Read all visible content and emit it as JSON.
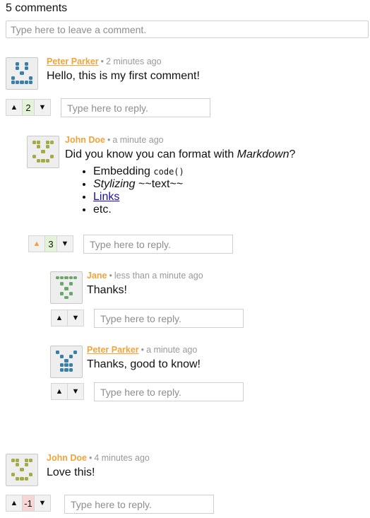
{
  "header": {
    "comment_count": "5 comments"
  },
  "new_comment": {
    "placeholder": "Type here to leave a comment."
  },
  "reply_placeholder": "Type here to reply.",
  "separator": "•",
  "vote": {
    "up_glyph": "▲",
    "down_glyph": "▼"
  },
  "colors": {
    "author": "#f2a33a",
    "positive": "#e3f4d8",
    "negative": "#f8d6d6",
    "avatar_blue": "#3a7fa8",
    "avatar_olive": "#a4aa45",
    "avatar_green": "#6aa86a"
  },
  "comments": [
    {
      "author": "Peter Parker",
      "time": "2 minutes ago",
      "text": "Hello, this is my first comment!",
      "score": "2",
      "avatar": "blue-robot-face"
    },
    {
      "author": "John Doe",
      "time": "a minute ago",
      "text_pre": "Did you know you can format with ",
      "text_em": "Markdown",
      "text_post": "?",
      "list": {
        "item1_text": "Embedding ",
        "item1_code": "code()",
        "item2_em": "Stylizing",
        "item2_text": " ~~text~~",
        "item3_link": "Links",
        "item4_text": "etc."
      },
      "score": "3",
      "avatar": "olive-robot-face"
    },
    {
      "author": "Jane",
      "time": "less than a minute ago",
      "text": "Thanks!",
      "score": "",
      "avatar": "green-robot-face"
    },
    {
      "author": "Peter Parker",
      "time": "a minute ago",
      "text": "Thanks, good to know!",
      "score": "",
      "avatar": "blue-robot-face"
    },
    {
      "author": "John Doe",
      "time": "4 minutes ago",
      "text": "Love this!",
      "score": "-1",
      "avatar": "olive-robot-face"
    }
  ]
}
